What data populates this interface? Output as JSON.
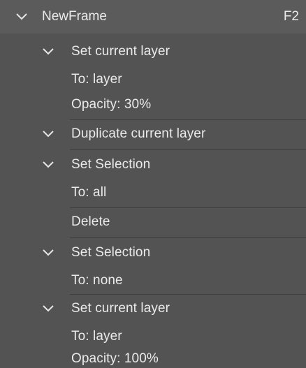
{
  "frame": {
    "title": "NewFrame",
    "shortcut": "F2"
  },
  "steps": [
    {
      "label": "Set current layer",
      "params": [
        "To: layer",
        "Opacity: 30%"
      ]
    },
    {
      "label": "Duplicate current layer",
      "params": []
    },
    {
      "label": "Set Selection",
      "params": [
        "To: all"
      ]
    },
    {
      "label": "Delete",
      "params": []
    },
    {
      "label": "Set Selection",
      "params": [
        "To: none"
      ]
    },
    {
      "label": "Set current layer",
      "params": [
        "To: layer",
        "Opacity: 100%"
      ]
    }
  ],
  "icons": {
    "expand": "chevron-down-icon"
  },
  "colors": {
    "panel_bg": "#535353",
    "header_bg": "#5b5b5b",
    "text": "#eaeaea",
    "divider": "#3e3e3e"
  }
}
